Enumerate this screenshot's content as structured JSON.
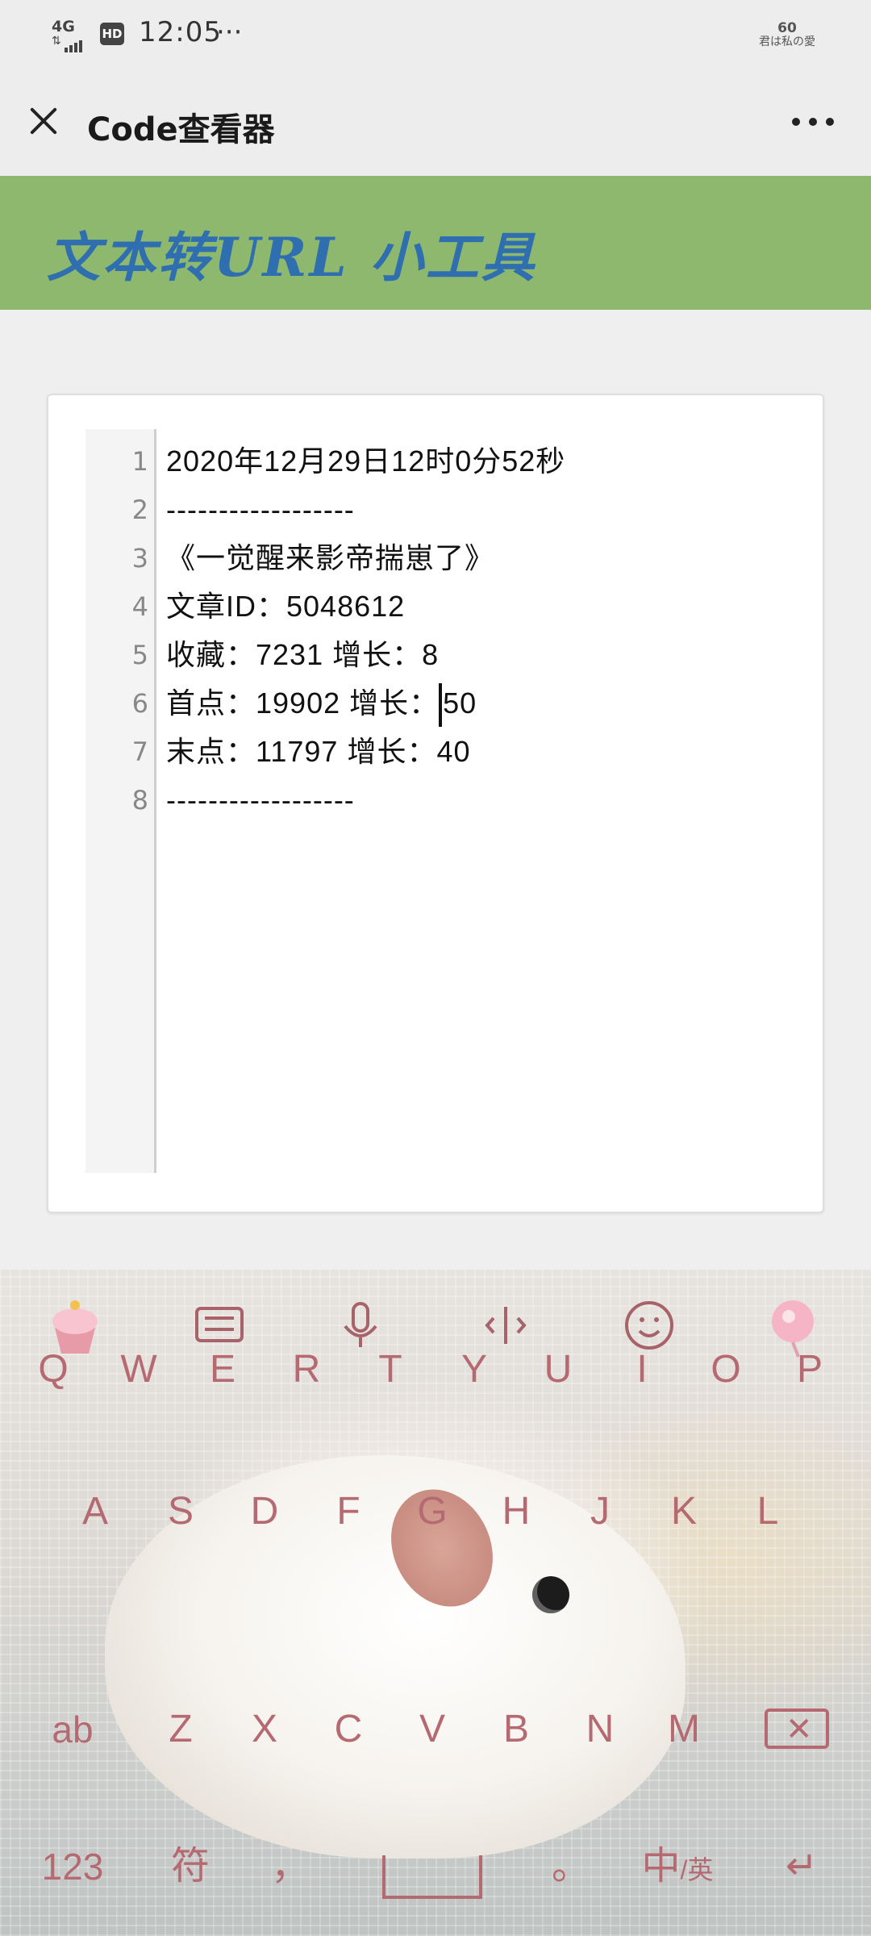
{
  "status_bar": {
    "network": "4G",
    "hd": "HD",
    "time": "12:05",
    "more": "···",
    "badge_number": "60",
    "badge_text": "君は私の愛"
  },
  "titlebar": {
    "title": "Code查看器"
  },
  "banner": {
    "title": "文本转URL 小工具"
  },
  "editor": {
    "lines": [
      {
        "n": "1",
        "text": "2020年12月29日12时0分52秒"
      },
      {
        "n": "2",
        "text": "------------------"
      },
      {
        "n": "3",
        "text": "《一觉醒来影帝揣崽了》"
      },
      {
        "n": "4",
        "text": "文章ID：5048612"
      },
      {
        "n": "5",
        "text": "收藏：7231 增长：8"
      },
      {
        "n": "6",
        "text_before": "首点：19902 增长：",
        "text_after": "50"
      },
      {
        "n": "7",
        "text": "末点：11797 增长：40"
      },
      {
        "n": "8",
        "text": "------------------"
      }
    ]
  },
  "keyboard": {
    "toolbar_icons": [
      "cupcake-icon",
      "keyboard-icon",
      "microphone-icon",
      "cursor-move-icon",
      "emoji-icon",
      "lollipop-icon"
    ],
    "row1": [
      "Q",
      "W",
      "E",
      "R",
      "T",
      "Y",
      "U",
      "I",
      "O",
      "P"
    ],
    "row2": [
      "A",
      "S",
      "D",
      "F",
      "G",
      "H",
      "J",
      "K",
      "L"
    ],
    "row3": [
      "ab",
      "Z",
      "X",
      "C",
      "V",
      "B",
      "N",
      "M"
    ],
    "row4": {
      "numbers": "123",
      "symbols": "符",
      "comma": "，",
      "period": "。",
      "lang_main": "中",
      "lang_sub": "/英",
      "enter": "↵"
    },
    "backspace": "✕"
  }
}
